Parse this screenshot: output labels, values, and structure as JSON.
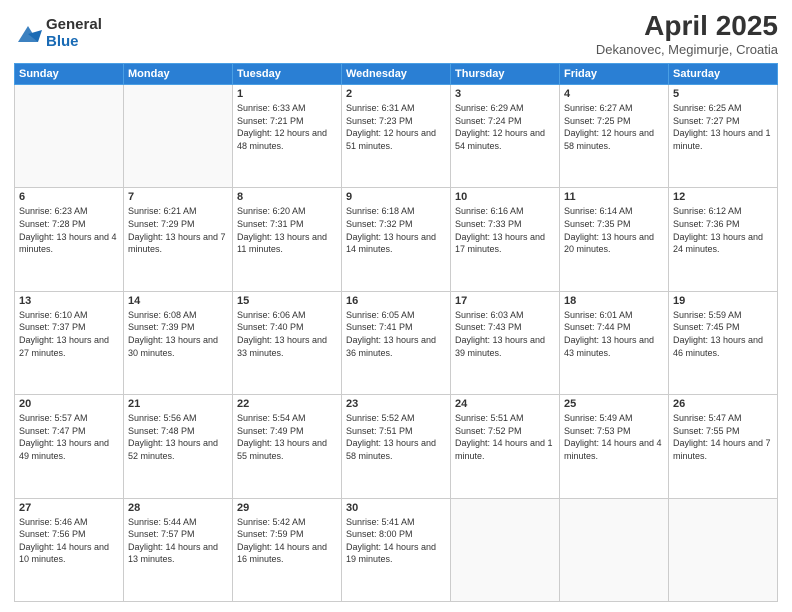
{
  "header": {
    "logo": {
      "general": "General",
      "blue": "Blue"
    },
    "title": "April 2025",
    "location": "Dekanovec, Megimurje, Croatia"
  },
  "weekdays": [
    "Sunday",
    "Monday",
    "Tuesday",
    "Wednesday",
    "Thursday",
    "Friday",
    "Saturday"
  ],
  "weeks": [
    [
      {
        "day": "",
        "info": ""
      },
      {
        "day": "",
        "info": ""
      },
      {
        "day": "1",
        "info": "Sunrise: 6:33 AM\nSunset: 7:21 PM\nDaylight: 12 hours and 48 minutes."
      },
      {
        "day": "2",
        "info": "Sunrise: 6:31 AM\nSunset: 7:23 PM\nDaylight: 12 hours and 51 minutes."
      },
      {
        "day": "3",
        "info": "Sunrise: 6:29 AM\nSunset: 7:24 PM\nDaylight: 12 hours and 54 minutes."
      },
      {
        "day": "4",
        "info": "Sunrise: 6:27 AM\nSunset: 7:25 PM\nDaylight: 12 hours and 58 minutes."
      },
      {
        "day": "5",
        "info": "Sunrise: 6:25 AM\nSunset: 7:27 PM\nDaylight: 13 hours and 1 minute."
      }
    ],
    [
      {
        "day": "6",
        "info": "Sunrise: 6:23 AM\nSunset: 7:28 PM\nDaylight: 13 hours and 4 minutes."
      },
      {
        "day": "7",
        "info": "Sunrise: 6:21 AM\nSunset: 7:29 PM\nDaylight: 13 hours and 7 minutes."
      },
      {
        "day": "8",
        "info": "Sunrise: 6:20 AM\nSunset: 7:31 PM\nDaylight: 13 hours and 11 minutes."
      },
      {
        "day": "9",
        "info": "Sunrise: 6:18 AM\nSunset: 7:32 PM\nDaylight: 13 hours and 14 minutes."
      },
      {
        "day": "10",
        "info": "Sunrise: 6:16 AM\nSunset: 7:33 PM\nDaylight: 13 hours and 17 minutes."
      },
      {
        "day": "11",
        "info": "Sunrise: 6:14 AM\nSunset: 7:35 PM\nDaylight: 13 hours and 20 minutes."
      },
      {
        "day": "12",
        "info": "Sunrise: 6:12 AM\nSunset: 7:36 PM\nDaylight: 13 hours and 24 minutes."
      }
    ],
    [
      {
        "day": "13",
        "info": "Sunrise: 6:10 AM\nSunset: 7:37 PM\nDaylight: 13 hours and 27 minutes."
      },
      {
        "day": "14",
        "info": "Sunrise: 6:08 AM\nSunset: 7:39 PM\nDaylight: 13 hours and 30 minutes."
      },
      {
        "day": "15",
        "info": "Sunrise: 6:06 AM\nSunset: 7:40 PM\nDaylight: 13 hours and 33 minutes."
      },
      {
        "day": "16",
        "info": "Sunrise: 6:05 AM\nSunset: 7:41 PM\nDaylight: 13 hours and 36 minutes."
      },
      {
        "day": "17",
        "info": "Sunrise: 6:03 AM\nSunset: 7:43 PM\nDaylight: 13 hours and 39 minutes."
      },
      {
        "day": "18",
        "info": "Sunrise: 6:01 AM\nSunset: 7:44 PM\nDaylight: 13 hours and 43 minutes."
      },
      {
        "day": "19",
        "info": "Sunrise: 5:59 AM\nSunset: 7:45 PM\nDaylight: 13 hours and 46 minutes."
      }
    ],
    [
      {
        "day": "20",
        "info": "Sunrise: 5:57 AM\nSunset: 7:47 PM\nDaylight: 13 hours and 49 minutes."
      },
      {
        "day": "21",
        "info": "Sunrise: 5:56 AM\nSunset: 7:48 PM\nDaylight: 13 hours and 52 minutes."
      },
      {
        "day": "22",
        "info": "Sunrise: 5:54 AM\nSunset: 7:49 PM\nDaylight: 13 hours and 55 minutes."
      },
      {
        "day": "23",
        "info": "Sunrise: 5:52 AM\nSunset: 7:51 PM\nDaylight: 13 hours and 58 minutes."
      },
      {
        "day": "24",
        "info": "Sunrise: 5:51 AM\nSunset: 7:52 PM\nDaylight: 14 hours and 1 minute."
      },
      {
        "day": "25",
        "info": "Sunrise: 5:49 AM\nSunset: 7:53 PM\nDaylight: 14 hours and 4 minutes."
      },
      {
        "day": "26",
        "info": "Sunrise: 5:47 AM\nSunset: 7:55 PM\nDaylight: 14 hours and 7 minutes."
      }
    ],
    [
      {
        "day": "27",
        "info": "Sunrise: 5:46 AM\nSunset: 7:56 PM\nDaylight: 14 hours and 10 minutes."
      },
      {
        "day": "28",
        "info": "Sunrise: 5:44 AM\nSunset: 7:57 PM\nDaylight: 14 hours and 13 minutes."
      },
      {
        "day": "29",
        "info": "Sunrise: 5:42 AM\nSunset: 7:59 PM\nDaylight: 14 hours and 16 minutes."
      },
      {
        "day": "30",
        "info": "Sunrise: 5:41 AM\nSunset: 8:00 PM\nDaylight: 14 hours and 19 minutes."
      },
      {
        "day": "",
        "info": ""
      },
      {
        "day": "",
        "info": ""
      },
      {
        "day": "",
        "info": ""
      }
    ]
  ]
}
